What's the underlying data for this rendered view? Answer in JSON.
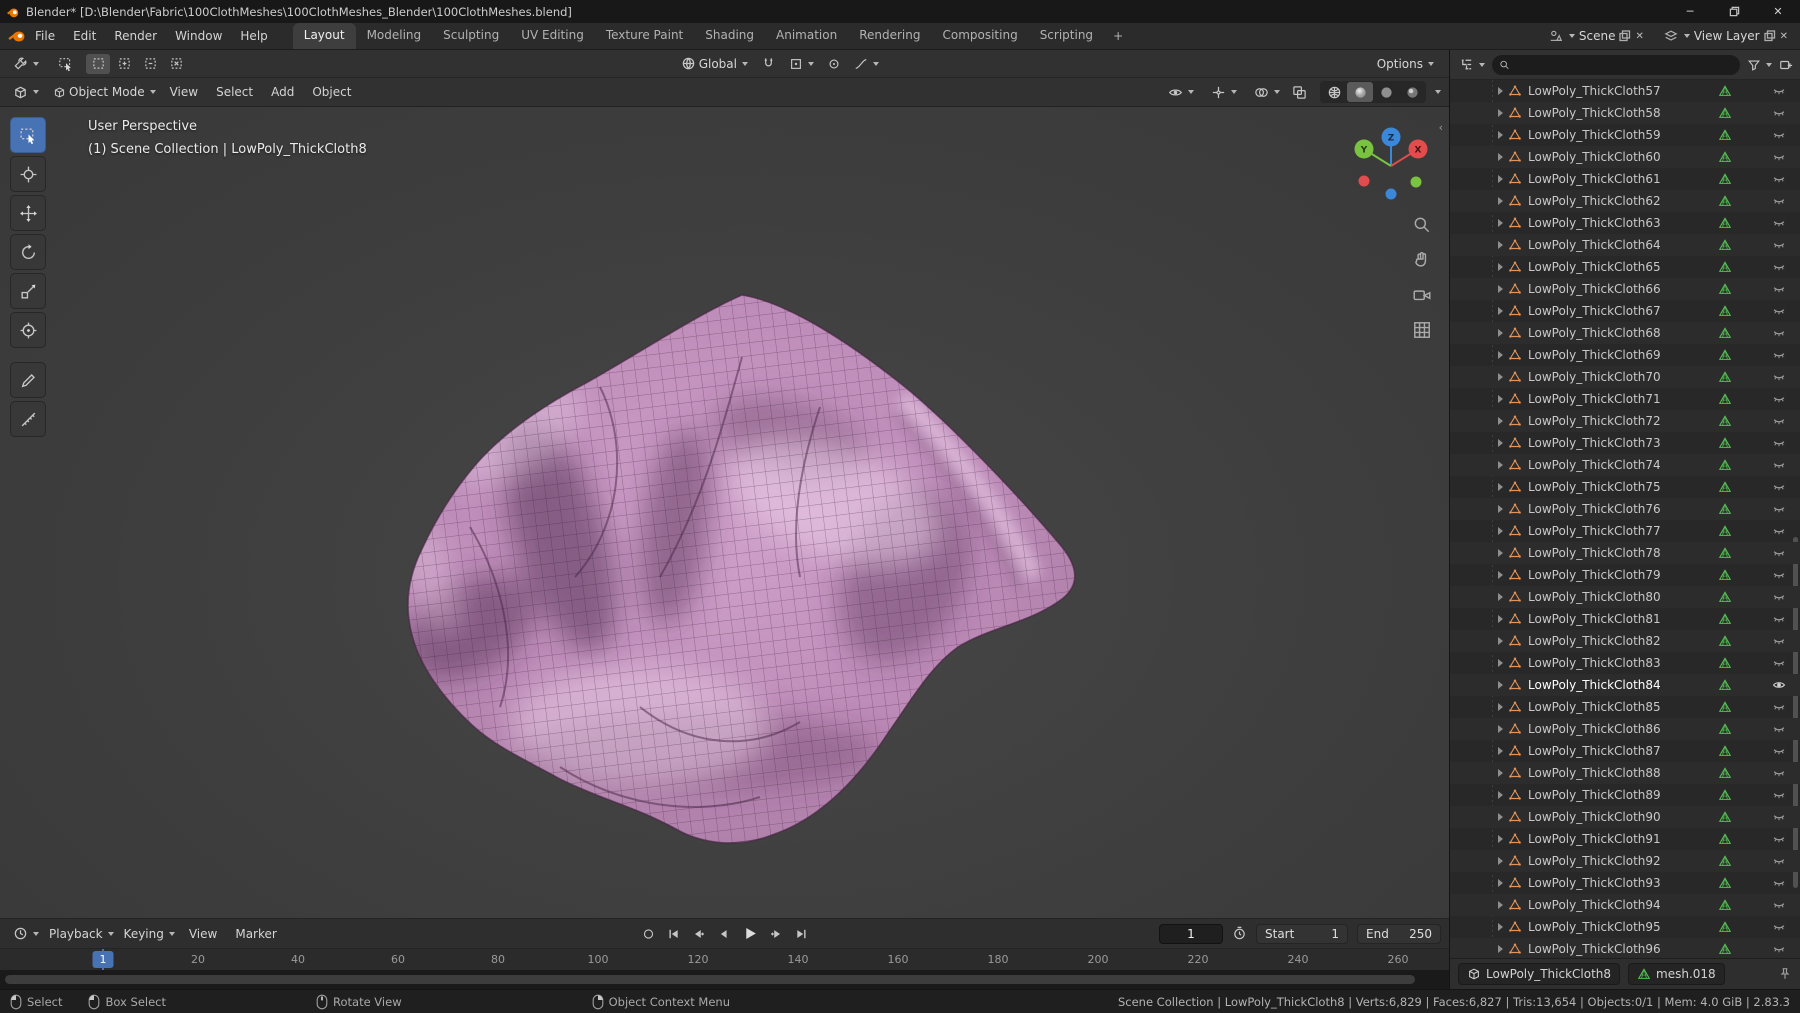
{
  "window": {
    "title": "Blender* [D:\\Blender\\Fabric\\100ClothMeshes\\100ClothMeshes_Blender\\100ClothMeshes.blend]"
  },
  "topbar": {
    "menus": [
      "File",
      "Edit",
      "Render",
      "Window",
      "Help"
    ],
    "tabs": [
      "Layout",
      "Modeling",
      "Sculpting",
      "UV Editing",
      "Texture Paint",
      "Shading",
      "Animation",
      "Rendering",
      "Compositing",
      "Scripting"
    ],
    "active_tab": "Layout",
    "new_tab_label": "+",
    "scene_label": "Scene",
    "view_layer_label": "View Layer"
  },
  "tool_settings": {
    "orientation_label": "Global",
    "options_label": "Options"
  },
  "viewport": {
    "header": {
      "mode": "Object Mode",
      "menus": [
        "View",
        "Select",
        "Add",
        "Object"
      ]
    },
    "overlay": {
      "line1": "User Perspective",
      "line2": "(1) Scene Collection | LowPoly_ThickCloth8"
    }
  },
  "timeline": {
    "menus": [
      "Playback",
      "Keying",
      "View",
      "Marker"
    ],
    "current_frame": "1",
    "frame_badge": "1",
    "start_label": "Start",
    "start_value": "1",
    "end_label": "End",
    "end_value": "250",
    "ruler_marks": [
      20,
      40,
      60,
      80,
      100,
      120,
      140,
      160,
      180,
      200,
      220,
      240,
      260
    ]
  },
  "outliner": {
    "search_placeholder": "",
    "selected": "LowPoly_ThickCloth84",
    "items": [
      "LowPoly_ThickCloth57",
      "LowPoly_ThickCloth58",
      "LowPoly_ThickCloth59",
      "LowPoly_ThickCloth60",
      "LowPoly_ThickCloth61",
      "LowPoly_ThickCloth62",
      "LowPoly_ThickCloth63",
      "LowPoly_ThickCloth64",
      "LowPoly_ThickCloth65",
      "LowPoly_ThickCloth66",
      "LowPoly_ThickCloth67",
      "LowPoly_ThickCloth68",
      "LowPoly_ThickCloth69",
      "LowPoly_ThickCloth70",
      "LowPoly_ThickCloth71",
      "LowPoly_ThickCloth72",
      "LowPoly_ThickCloth73",
      "LowPoly_ThickCloth74",
      "LowPoly_ThickCloth75",
      "LowPoly_ThickCloth76",
      "LowPoly_ThickCloth77",
      "LowPoly_ThickCloth78",
      "LowPoly_ThickCloth79",
      "LowPoly_ThickCloth80",
      "LowPoly_ThickCloth81",
      "LowPoly_ThickCloth82",
      "LowPoly_ThickCloth83",
      "LowPoly_ThickCloth84",
      "LowPoly_ThickCloth85",
      "LowPoly_ThickCloth86",
      "LowPoly_ThickCloth87",
      "LowPoly_ThickCloth88",
      "LowPoly_ThickCloth89",
      "LowPoly_ThickCloth90",
      "LowPoly_ThickCloth91",
      "LowPoly_ThickCloth92",
      "LowPoly_ThickCloth93",
      "LowPoly_ThickCloth94",
      "LowPoly_ThickCloth95",
      "LowPoly_ThickCloth96"
    ]
  },
  "properties_bar": {
    "object": "LowPoly_ThickCloth8",
    "data": "mesh.018"
  },
  "statusbar": {
    "hints": [
      {
        "icon": "mouse-left-icon",
        "label": "Select"
      },
      {
        "icon": "mouse-left-drag-icon",
        "label": "Box Select"
      },
      {
        "icon": "mouse-middle-icon",
        "label": "Rotate View"
      },
      {
        "icon": "mouse-right-icon",
        "label": "Object Context Menu"
      }
    ],
    "info": "Scene Collection | LowPoly_ThickCloth8 | Verts:6,829 | Faces:6,827 | Tris:13,654 | Objects:0/1 | Mem: 4.0 GiB | 2.83.3"
  },
  "colors": {
    "accent": "#4772b3",
    "mesh_object_orange": "#e3945a",
    "mesh_data_green": "#54c054",
    "cloth_pink": "#c495c0",
    "axis_x": "#e24c4c",
    "axis_y": "#79c341",
    "axis_z": "#3b87d9"
  }
}
